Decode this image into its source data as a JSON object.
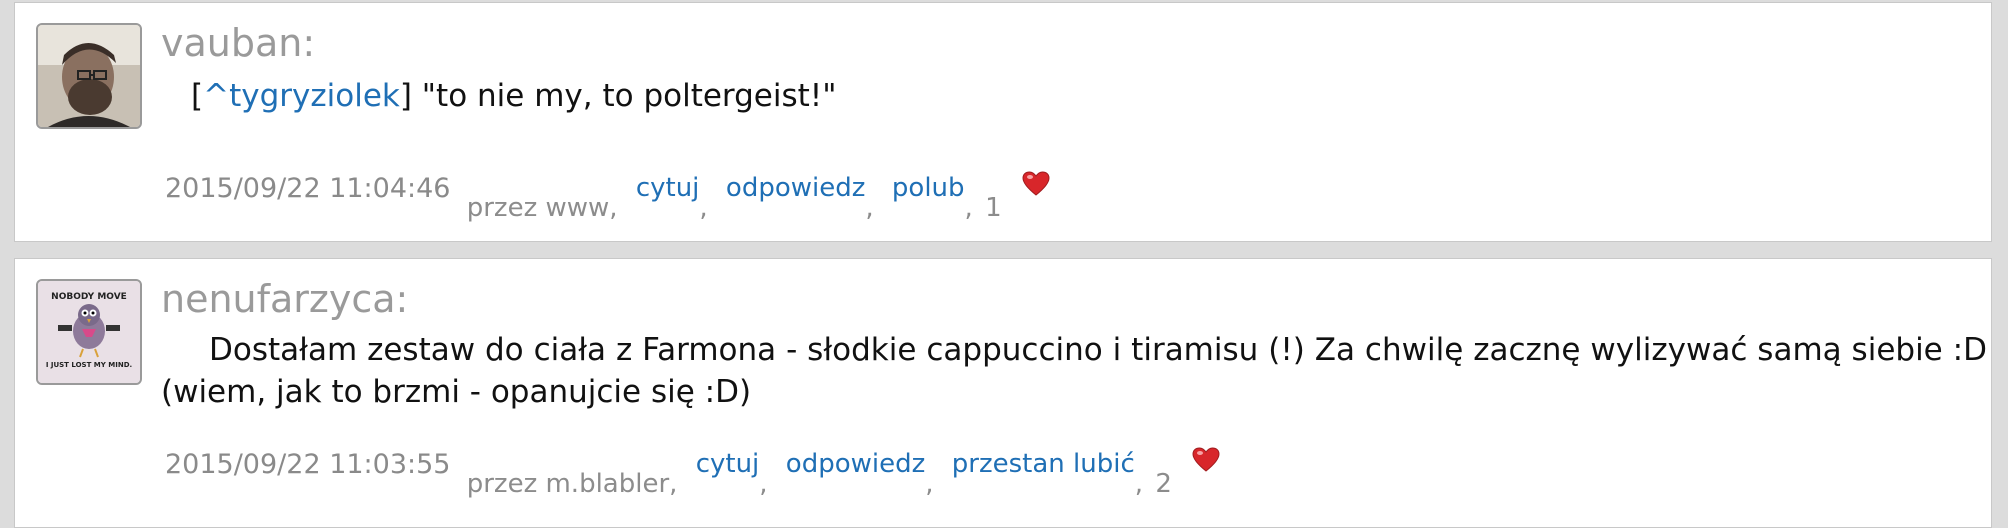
{
  "posts": [
    {
      "username": "vauban",
      "colon": ":",
      "avatar_icon": "man-portrait-avatar",
      "message_prefix": "[",
      "mention": "^tygryziolek",
      "message_suffix": "] \"to nie my, to poltergeist!\"",
      "timestamp": "2015/09/22 11:04:46",
      "via": "przez www,",
      "actions": [
        "cytuj",
        "odpowiedz",
        "polub"
      ],
      "like_count": "1",
      "heart_icon": "heart-icon"
    },
    {
      "username": "nenufarzyca",
      "colon": ":",
      "avatar_icon": "pigeon-nobody-move-avatar",
      "avatar_text_top": "NOBODY MOVE",
      "avatar_text_bottom": "I JUST LOST MY MIND.",
      "message": "Dostałam zestaw do ciała z Farmona - słodkie cappuccino i tiramisu (!) Za chwilę zacznę wylizywać samą siebie :D (wiem, jak to brzmi - opanujcie się :D)",
      "timestamp": "2015/09/22 11:03:55",
      "via": "przez m.blabler,",
      "actions": [
        "cytuj",
        "odpowiedz",
        "przestan lubić"
      ],
      "like_count": "2",
      "heart_icon": "heart-icon"
    }
  ],
  "colors": {
    "link": "#1f6fb5",
    "username": "#9a9a9a",
    "meta": "#8c8c8c",
    "heart": "#d8262a",
    "background": "#dcdcdc",
    "card": "#ffffff"
  }
}
